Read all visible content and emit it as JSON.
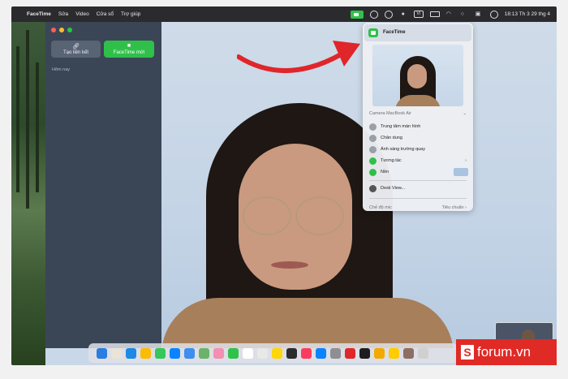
{
  "menubar": {
    "apple": "",
    "items": [
      "FaceTime",
      "Sửa",
      "Video",
      "Cửa sổ",
      "Trợ giúp"
    ],
    "input_label": "Vi",
    "clock": "18:13 Th 3 29 thg 4"
  },
  "sidebar": {
    "create_link_label": "Tạo liên kết",
    "new_facetime_label": "FaceTime mới",
    "section_today": "Hôm nay"
  },
  "dropdown": {
    "app_name": "FaceTime",
    "camera_section": "Camera MacBook Air",
    "items": [
      {
        "label": "Trung tâm màn hình",
        "icon": "center-stage-icon",
        "green": false,
        "has_arrow": false
      },
      {
        "label": "Chân dung",
        "icon": "portrait-icon",
        "green": false,
        "has_arrow": false
      },
      {
        "label": "Ánh sáng trường quay",
        "icon": "studio-light-icon",
        "green": false,
        "has_arrow": false
      },
      {
        "label": "Tương tác",
        "icon": "reactions-icon",
        "green": true,
        "has_arrow": true
      },
      {
        "label": "Nền",
        "icon": "background-icon",
        "green": true,
        "has_arrow": false
      }
    ],
    "desk_view": "Desk View...",
    "mic_mode_label": "Chế độ mic",
    "mic_mode_value": "Tiêu chuẩn"
  },
  "watermark": {
    "s": "S",
    "text": "forum.vn"
  },
  "colors": {
    "facetime_green": "#2fc04a",
    "arrow_red": "#e0262a",
    "sidebar_bg": "#3a4656"
  }
}
